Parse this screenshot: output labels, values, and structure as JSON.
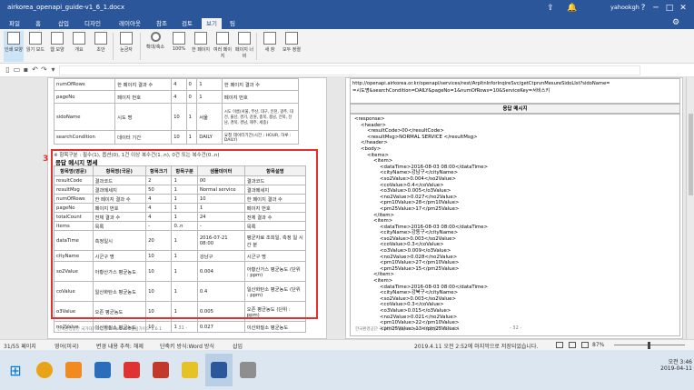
{
  "window": {
    "title": "airkorea_openapi_guide-v1_6_1.docx",
    "user": "yahookgh"
  },
  "tabs": [
    "파일",
    "홈",
    "삽입",
    "디자인",
    "레이아웃",
    "참조",
    "검토",
    "보기",
    "팀"
  ],
  "ribbon": {
    "buttons": [
      "인쇄 모양",
      "읽기 모드",
      "웹 모양",
      "개요",
      "초안",
      "눈금자",
      "눈금선",
      "탐색 창",
      "확대/축소",
      "100%",
      "한 페이지",
      "여러 페이지",
      "페이지 너비",
      "새 창",
      "모두 정렬",
      "나누기",
      "매크로"
    ],
    "group": "보기"
  },
  "left_page": {
    "top_rows": [
      [
        "numOfRows",
        "한 페이지 결과 수",
        "4",
        "0",
        "1",
        "한 페이지 결과 수"
      ],
      [
        "pageNo",
        "페이지 번호",
        "4",
        "0",
        "1",
        "페이지 번호"
      ],
      [
        "sidoName",
        "시도 명",
        "10",
        "1",
        "서울",
        "시도 이름(서울, 부산, 대구, 인천, 광주, 대전, 울산, 경기, 강원, 충북, 충남, 전북, 전남, 경북, 경남, 제주, 세종)"
      ],
      [
        "searchCondition",
        "데이터 기간",
        "10",
        "1",
        "DAILY",
        "요청 데이터기간(시간 : HOUR, 하루 : DAILY)"
      ]
    ],
    "note": "※ 항목구분 : 필수(1), 옵션(0), 1건 이상 복수건(1..n), 0건 또는 복수건(0..n)",
    "section_number": "3",
    "section_title": "응답 메시지 명세",
    "headers": [
      "항목명(영문)",
      "항목명(국문)",
      "항목크기",
      "항목구분",
      "샘플데이터",
      "항목설명"
    ],
    "rows": [
      [
        "resultCode",
        "결과코드",
        "2",
        "1",
        "00",
        "결과코드"
      ],
      [
        "resultMsg",
        "결과메세지",
        "50",
        "1",
        "Normal service",
        "결과메세지"
      ],
      [
        "numOfRows",
        "한 페이지 결과 수",
        "4",
        "1",
        "10",
        "한 페이지 결과 수"
      ],
      [
        "pageNo",
        "페이지 번호",
        "4",
        "1",
        "1",
        "페이지 번호"
      ],
      [
        "totalCount",
        "전체 결과 수",
        "4",
        "1",
        "24",
        "전체 결과 수"
      ],
      [
        "items",
        "목록",
        "-",
        "0..n",
        "-",
        "목록"
      ],
      [
        "dataTime",
        "측정일시",
        "20",
        "1",
        "2016-07-21 08:00",
        "평균자료 조회일, 측정 일 시간 분"
      ],
      [
        "cityName",
        "시군구 명",
        "10",
        "1",
        "강남구",
        "시군구 명"
      ],
      [
        "so2Value",
        "아황산가스 평균농도",
        "10",
        "1",
        "0.004",
        "아황산가스 평균농도 (단위 : ppm)"
      ],
      [
        "coValue",
        "일산화탄소 평균농도",
        "10",
        "1",
        "0.4",
        "일산화탄소 평균농도 (단위 : ppm)"
      ],
      [
        "o3Value",
        "오존 평균농도",
        "10",
        "1",
        "0.005",
        "오존 평균농도 (단위 : ppm)"
      ],
      [
        "no2Value",
        "이산화질소 평균농도",
        "10",
        "1",
        "0.027",
        "이산화질소 평균농도"
      ]
    ],
    "footer": "한국환경공단 국가대기오염정보 OpenAPI 활용가이드  1.6.1",
    "page_number": "- 31 -"
  },
  "right_page": {
    "url_line1": "http://openapi.airkorea.or.kr/openapi/services/rest/ArpltnInforInqireSvc/getCtprvnMesureSidoLIst?sidoName=",
    "url_line2": "=시도명&searchCondition=DAILY&pageNo=1&numOfRows=10&ServiceKey=서비스키",
    "response_header": "응답 메시지",
    "xml_lines": [
      "<response>",
      "<header>",
      "<resultCode>00</resultCode>",
      "<resultMsg>NORMAL SERVICE </resultMsg>",
      "</header>",
      "<body>",
      "<items>",
      "<item>",
      "<dataTime>2016-08-03 08:00</dataTime>",
      "<cityName>강남구</cityName>",
      "<so2Value>0.004</so2Value>",
      "<coValue>0.4</coValue>",
      "<o3Value>0.005</o3Value>",
      "<no2Value>0.027</no2Value>",
      "<pm10Value>28</pm10Value>",
      "<pm25Value>17</pm25Value>",
      "</item>",
      "<item>",
      "<dataTime>2016-08-03 08:00</dataTime>",
      "<cityName>강동구</cityName>",
      "<so2Value>0.003</so2Value>",
      "<coValue>0.3</coValue>",
      "<o3Value>0.009</o3Value>",
      "<no2Value>0.028</no2Value>",
      "<pm10Value>27</pm10Value>",
      "<pm25Value>15</pm25Value>",
      "</item>",
      "<item>",
      "<dataTime>2016-08-03 08:00</dataTime>",
      "<cityName>강북구</cityName>",
      "<so2Value>0.003</so2Value>",
      "<coValue>0.3</coValue>",
      "<o3Value>0.015</o3Value>",
      "<no2Value>0.021</no2Value>",
      "<pm10Value>22</pm10Value>",
      "<pm25Value>13</pm25Value>"
    ],
    "footer": "한국환경공단 국가대기오염정보 OpenAPI 활용가이드  1.6.1",
    "page_number": "- 32 -"
  },
  "status": {
    "page": "31/55 페이지",
    "lang": "영어(미국)",
    "track": "변경 내용 추적: 해제",
    "mode": "단축키 방식:Word 방식",
    "insert": "삽입",
    "saved": "2019.4.11 오전 2:52에 마지막으로 저장되었습니다.",
    "zoom": "87%"
  },
  "clock": {
    "time": "오전 3:46",
    "date": "2019-04-11"
  }
}
